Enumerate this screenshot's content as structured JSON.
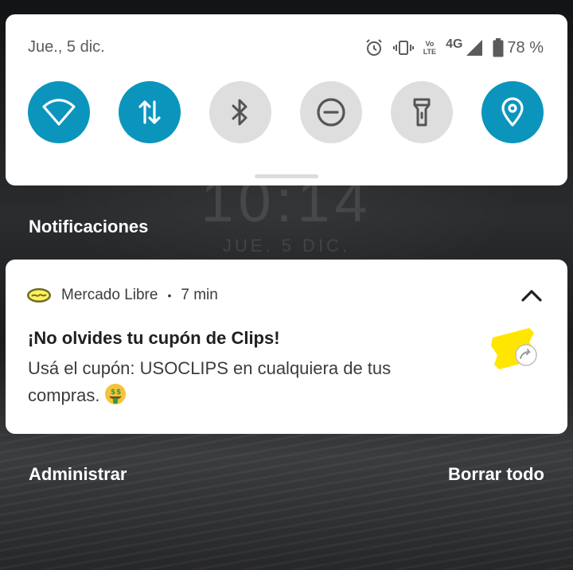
{
  "wallpaper": {
    "clock": "10:14",
    "date": "JUE. 5 DIC."
  },
  "status_bar": {
    "date": "Jue., 5 dic.",
    "icons": [
      "alarm-icon",
      "vibrate-icon",
      "volte-icon",
      "signal-icon",
      "battery-icon"
    ],
    "lte_top": "Vo",
    "lte_bottom": "LTE",
    "network_type": "4G",
    "battery_percent": "78 %"
  },
  "quick_settings": {
    "tiles": [
      {
        "name": "wifi",
        "icon": "wifi-icon",
        "active": true
      },
      {
        "name": "mobile-data",
        "icon": "data-arrows-icon",
        "active": true
      },
      {
        "name": "bluetooth",
        "icon": "bluetooth-icon",
        "active": false
      },
      {
        "name": "do-not-disturb",
        "icon": "dnd-icon",
        "active": false
      },
      {
        "name": "flashlight",
        "icon": "flashlight-icon",
        "active": false
      },
      {
        "name": "location",
        "icon": "location-icon",
        "active": true
      }
    ],
    "accent_color": "#0b95bd",
    "inactive_color": "#dedede"
  },
  "notifications": {
    "header": "Notificaciones",
    "items": [
      {
        "app_name": "Mercado Libre",
        "separator": "•",
        "time": "7 min",
        "title": "¡No olvides tu cupón de Clips!",
        "body": "Usá el cupón: USOCLIPS en cualquiera de tus compras.",
        "app_icon": "mercadolibre-logo-icon",
        "thumbnail": "coupon-ticket-icon",
        "brand_color": "#fff159"
      }
    ],
    "actions": {
      "manage": "Administrar",
      "clear_all": "Borrar todo"
    }
  }
}
